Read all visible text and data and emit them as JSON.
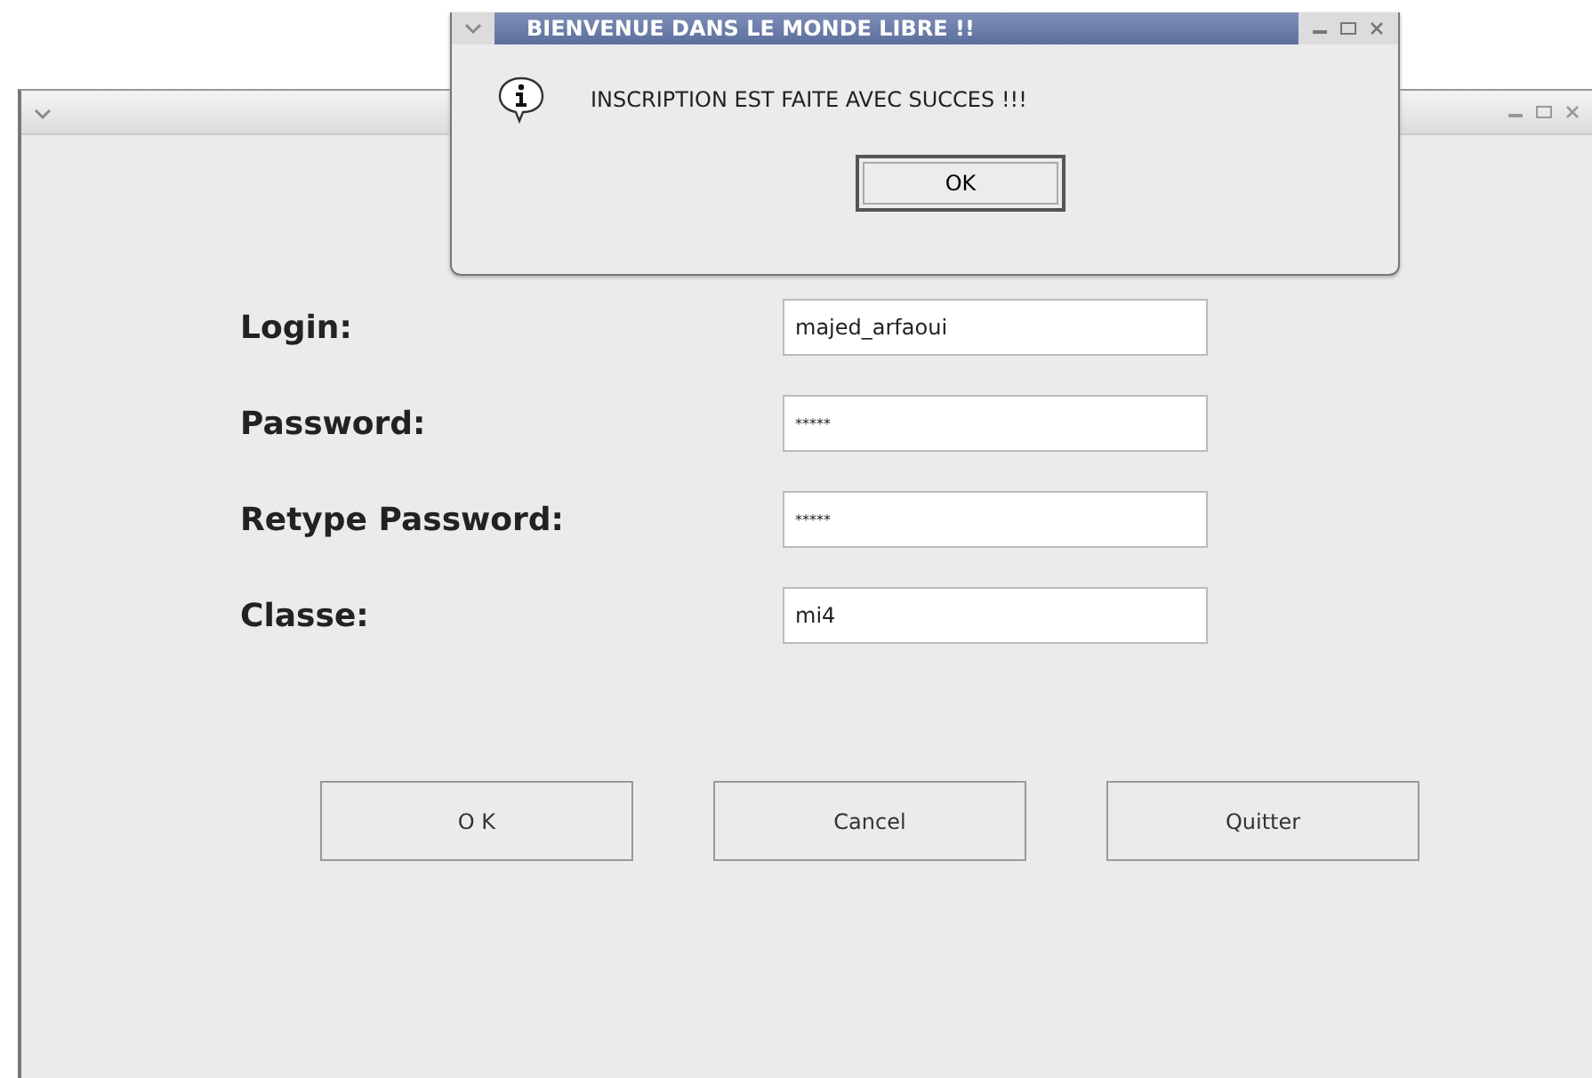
{
  "main_window": {
    "fields": [
      {
        "label": "Login:",
        "value": "majed_arfaoui",
        "kind": "text"
      },
      {
        "label": "Password:",
        "value": "*****",
        "kind": "secret"
      },
      {
        "label": "Retype Password:",
        "value": "*****",
        "kind": "secret"
      },
      {
        "label": "Classe:",
        "value": "mi4",
        "kind": "text"
      }
    ],
    "buttons": [
      "O K",
      "Cancel",
      "Quitter"
    ]
  },
  "dialog": {
    "title": "BIENVENUE DANS LE MONDE LIBRE !!",
    "message": "INSCRIPTION EST FAITE AVEC SUCCES  !!!",
    "button": "OK"
  }
}
